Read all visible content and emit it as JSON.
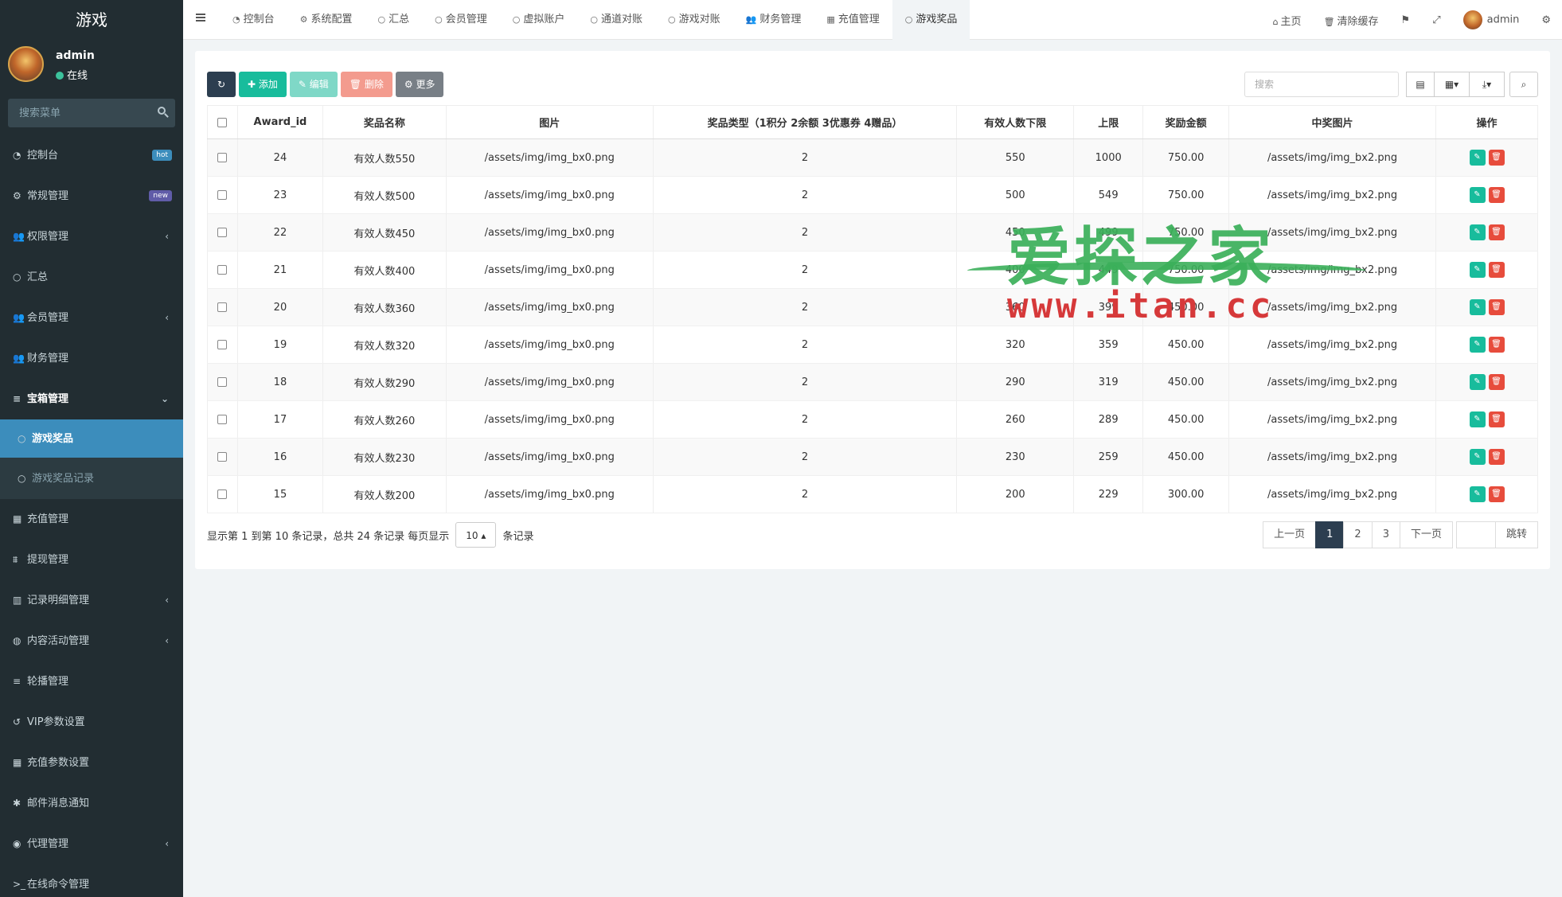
{
  "app": {
    "title": "游戏"
  },
  "user": {
    "name": "admin",
    "status": "在线"
  },
  "sidebar": {
    "search_placeholder": "搜索菜单",
    "items": [
      {
        "icon": "dashboard-icon",
        "glyph": "◔",
        "label": "控制台",
        "badge": "hot"
      },
      {
        "icon": "cogs-icon",
        "glyph": "⚙",
        "label": "常规管理",
        "badge": "new"
      },
      {
        "icon": "users-icon",
        "glyph": "👥",
        "label": "权限管理",
        "chevron": "‹"
      },
      {
        "icon": "circle-icon",
        "glyph": "○",
        "label": "汇总"
      },
      {
        "icon": "users-icon",
        "glyph": "👥",
        "label": "会员管理",
        "chevron": "‹"
      },
      {
        "icon": "users-icon",
        "glyph": "👥",
        "label": "财务管理"
      },
      {
        "icon": "list-icon",
        "glyph": "≡",
        "label": "宝箱管理",
        "chevron": "⌄"
      },
      {
        "icon": "circle-icon",
        "glyph": "○",
        "label": "游戏奖品"
      },
      {
        "icon": "circle-icon",
        "glyph": "○",
        "label": "游戏奖品记录"
      },
      {
        "icon": "th-large-icon",
        "glyph": "▦",
        "label": "充值管理"
      },
      {
        "icon": "bank-icon",
        "glyph": "⩩",
        "label": "提现管理"
      },
      {
        "icon": "bar-chart-icon",
        "glyph": "▥",
        "label": "记录明细管理",
        "chevron": "‹"
      },
      {
        "icon": "globe-icon",
        "glyph": "◍",
        "label": "内容活动管理",
        "chevron": "‹"
      },
      {
        "icon": "bars-icon",
        "glyph": "≡",
        "label": "轮播管理"
      },
      {
        "icon": "history-icon",
        "glyph": "↺",
        "label": "VIP参数设置"
      },
      {
        "icon": "th-icon",
        "glyph": "▦",
        "label": "充值参数设置"
      },
      {
        "icon": "asterisk-icon",
        "glyph": "✱",
        "label": "邮件消息通知"
      },
      {
        "icon": "user-circle-icon",
        "glyph": "◉",
        "label": "代理管理",
        "chevron": "‹"
      },
      {
        "icon": "terminal-icon",
        "glyph": ">_",
        "label": "在线命令管理"
      }
    ]
  },
  "topbar": {
    "tabs": [
      {
        "icon": "dashboard-icon",
        "glyph": "◔",
        "label": "控制台"
      },
      {
        "icon": "cog-icon",
        "glyph": "⚙",
        "label": "系统配置"
      },
      {
        "icon": "circle-icon",
        "glyph": "○",
        "label": "汇总"
      },
      {
        "icon": "circle-icon",
        "glyph": "○",
        "label": "会员管理"
      },
      {
        "icon": "circle-icon",
        "glyph": "○",
        "label": "虚拟账户"
      },
      {
        "icon": "circle-icon",
        "glyph": "○",
        "label": "通道对账"
      },
      {
        "icon": "circle-icon",
        "glyph": "○",
        "label": "游戏对账"
      },
      {
        "icon": "users-icon",
        "glyph": "👥",
        "label": "财务管理"
      },
      {
        "icon": "th-large-icon",
        "glyph": "▦",
        "label": "充值管理"
      },
      {
        "icon": "circle-icon",
        "glyph": "○",
        "label": "游戏奖品"
      }
    ],
    "home": "主页",
    "clear_cache": "清除缓存",
    "admin": "admin"
  },
  "toolbar": {
    "add": "添加",
    "edit": "编辑",
    "delete": "删除",
    "more": "更多",
    "search_placeholder": "搜索"
  },
  "table": {
    "columns": [
      "Award_id",
      "奖品名称",
      "图片",
      "奖品类型（1积分 2余额 3优惠券 4赠品）",
      "有效人数下限",
      "上限",
      "奖励金额",
      "中奖图片",
      "操作"
    ],
    "rows": [
      [
        "24",
        "有效人数550",
        "/assets/img/img_bx0.png",
        "2",
        "550",
        "1000",
        "750.00",
        "/assets/img/img_bx2.png"
      ],
      [
        "23",
        "有效人数500",
        "/assets/img/img_bx0.png",
        "2",
        "500",
        "549",
        "750.00",
        "/assets/img/img_bx2.png"
      ],
      [
        "22",
        "有效人数450",
        "/assets/img/img_bx0.png",
        "2",
        "450",
        "499",
        "750.00",
        "/assets/img/img_bx2.png"
      ],
      [
        "21",
        "有效人数400",
        "/assets/img/img_bx0.png",
        "2",
        "400",
        "449",
        "750.00",
        "/assets/img/img_bx2.png"
      ],
      [
        "20",
        "有效人数360",
        "/assets/img/img_bx0.png",
        "2",
        "360",
        "399",
        "450.00",
        "/assets/img/img_bx2.png"
      ],
      [
        "19",
        "有效人数320",
        "/assets/img/img_bx0.png",
        "2",
        "320",
        "359",
        "450.00",
        "/assets/img/img_bx2.png"
      ],
      [
        "18",
        "有效人数290",
        "/assets/img/img_bx0.png",
        "2",
        "290",
        "319",
        "450.00",
        "/assets/img/img_bx2.png"
      ],
      [
        "17",
        "有效人数260",
        "/assets/img/img_bx0.png",
        "2",
        "260",
        "289",
        "450.00",
        "/assets/img/img_bx2.png"
      ],
      [
        "16",
        "有效人数230",
        "/assets/img/img_bx0.png",
        "2",
        "230",
        "259",
        "450.00",
        "/assets/img/img_bx2.png"
      ],
      [
        "15",
        "有效人数200",
        "/assets/img/img_bx0.png",
        "2",
        "200",
        "229",
        "300.00",
        "/assets/img/img_bx2.png"
      ]
    ]
  },
  "pagination": {
    "info": "显示第 1 到第 10 条记录，总共 24 条记录 每页显示",
    "page_size": "10",
    "suffix": "条记录",
    "prev": "上一页",
    "pages": [
      "1",
      "2",
      "3"
    ],
    "current": "1",
    "next": "下一页",
    "jump": "跳转"
  },
  "watermark": {
    "cn": "爱探之家",
    "url": "www.itan.cc"
  }
}
